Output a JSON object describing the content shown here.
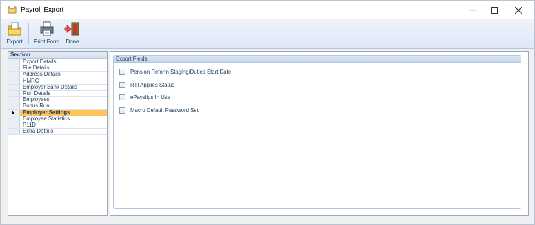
{
  "window": {
    "title": "Payroll Export"
  },
  "toolbar": {
    "buttons": [
      {
        "label": "Export",
        "icon": "export-icon"
      },
      {
        "label": "Print Form",
        "icon": "print-form-icon"
      },
      {
        "label": "Done",
        "icon": "done-icon"
      }
    ]
  },
  "sidebar": {
    "header": "Section",
    "items": [
      "Export Details",
      "File Details",
      "Address Details",
      "HMRC",
      "Employer Bank Details",
      "Run Details",
      "Employees",
      "Bonus Run",
      "Employer Settings",
      "Employee Statistics",
      "P11D",
      "Extra Details"
    ],
    "selected_index": 8
  },
  "main": {
    "group_title": "Export Fields",
    "fields": [
      {
        "label": "Pension Reform Staging/Duties Start Date",
        "checked": false
      },
      {
        "label": "RTI Applies Status",
        "checked": false
      },
      {
        "label": "ePayslips In Use",
        "checked": false
      },
      {
        "label": "Macro Default Password Set",
        "checked": false
      }
    ]
  },
  "colors": {
    "selected_row": "#ffc45b",
    "toolbar_text": "#1e395b"
  }
}
